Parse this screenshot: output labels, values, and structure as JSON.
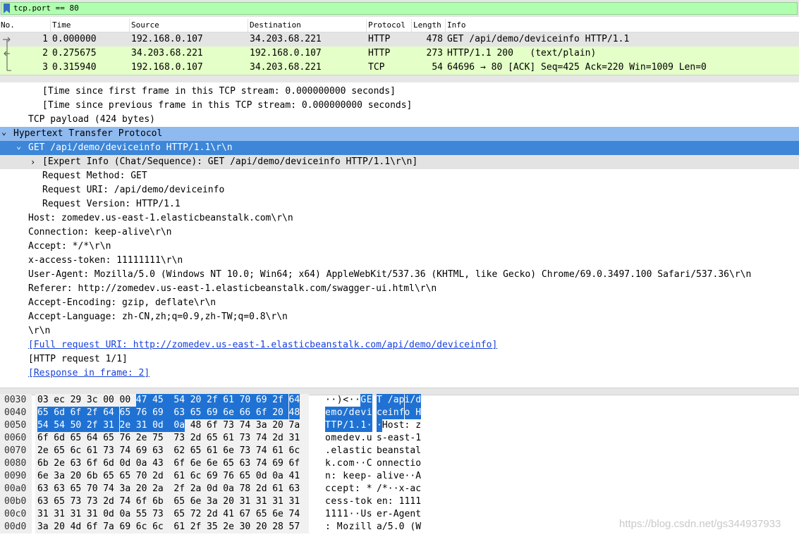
{
  "filter": {
    "value": "tcp.port == 80",
    "icon": "bookmark-icon",
    "bg_color": "#afffaf"
  },
  "packet_list": {
    "columns": [
      "No.",
      "Time",
      "Source",
      "Destination",
      "Protocol",
      "Length",
      "Info"
    ],
    "rows": [
      {
        "no": "1",
        "time": "0.000000",
        "source": "192.168.0.107",
        "destination": "34.203.68.221",
        "protocol": "HTTP",
        "length": "478",
        "info": "GET /api/demo/deviceinfo HTTP/1.1",
        "bg": "#e4e4e4"
      },
      {
        "no": "2",
        "time": "0.275675",
        "source": "34.203.68.221",
        "destination": "192.168.0.107",
        "protocol": "HTTP",
        "length": "273",
        "info": "HTTP/1.1 200   (text/plain)",
        "bg": "#e4ffc7"
      },
      {
        "no": "3",
        "time": "0.315940",
        "source": "192.168.0.107",
        "destination": "34.203.68.221",
        "protocol": "TCP",
        "length": "54",
        "info": "64696 → 80 [ACK] Seq=425 Ack=220 Win=1009 Len=0",
        "bg": "#e4ffc7"
      }
    ]
  },
  "details": [
    {
      "text": "[Time since first frame in this TCP stream: 0.000000000 seconds]",
      "indent": 3
    },
    {
      "text": "[Time since previous frame in this TCP stream: 0.000000000 seconds]",
      "indent": 3
    },
    {
      "text": "TCP payload (424 bytes)",
      "indent": 2
    },
    {
      "text": "Hypertext Transfer Protocol",
      "indent": 1,
      "caret": "expanded",
      "highlight": "light"
    },
    {
      "text": "GET /api/demo/deviceinfo HTTP/1.1\\r\\n",
      "indent": 2,
      "caret": "expanded",
      "highlight": "dark"
    },
    {
      "text": "[Expert Info (Chat/Sequence): GET /api/demo/deviceinfo HTTP/1.1\\r\\n]",
      "indent": 3,
      "caret": "collapsed",
      "highlight": "grey"
    },
    {
      "text": "Request Method: GET",
      "indent": 3
    },
    {
      "text": "Request URI: /api/demo/deviceinfo",
      "indent": 3
    },
    {
      "text": "Request Version: HTTP/1.1",
      "indent": 3
    },
    {
      "text": "Host: zomedev.us-east-1.elasticbeanstalk.com\\r\\n",
      "indent": 2
    },
    {
      "text": "Connection: keep-alive\\r\\n",
      "indent": 2
    },
    {
      "text": "Accept: */*\\r\\n",
      "indent": 2
    },
    {
      "text": "x-access-token: 11111111\\r\\n",
      "indent": 2
    },
    {
      "text": "User-Agent: Mozilla/5.0 (Windows NT 10.0; Win64; x64) AppleWebKit/537.36 (KHTML, like Gecko) Chrome/69.0.3497.100 Safari/537.36\\r\\n",
      "indent": 2
    },
    {
      "text": "Referer: http://zomedev.us-east-1.elasticbeanstalk.com/swagger-ui.html\\r\\n",
      "indent": 2
    },
    {
      "text": "Accept-Encoding: gzip, deflate\\r\\n",
      "indent": 2
    },
    {
      "text": "Accept-Language: zh-CN,zh;q=0.9,zh-TW;q=0.8\\r\\n",
      "indent": 2
    },
    {
      "text": "\\r\\n",
      "indent": 2
    },
    {
      "text": "[Full request URI: http://zomedev.us-east-1.elasticbeanstalk.com/api/demo/deviceinfo]",
      "indent": 2,
      "link": true
    },
    {
      "text": "[HTTP request 1/1]",
      "indent": 2
    },
    {
      "text": "[Response in frame: 2]",
      "indent": 2,
      "link": true
    }
  ],
  "bytes": [
    {
      "offset": "0030",
      "hex": [
        "03",
        "ec",
        "29",
        "3c",
        "00",
        "00",
        "47",
        "45",
        "54",
        "20",
        "2f",
        "61",
        "70",
        "69",
        "2f",
        "64"
      ],
      "ascii": "··)<··GET /api/d",
      "sel_start": 6,
      "sel_end": 16
    },
    {
      "offset": "0040",
      "hex": [
        "65",
        "6d",
        "6f",
        "2f",
        "64",
        "65",
        "76",
        "69",
        "63",
        "65",
        "69",
        "6e",
        "66",
        "6f",
        "20",
        "48"
      ],
      "ascii": "emo/deviceinfo H",
      "sel_start": 0,
      "sel_end": 16
    },
    {
      "offset": "0050",
      "hex": [
        "54",
        "54",
        "50",
        "2f",
        "31",
        "2e",
        "31",
        "0d",
        "0a",
        "48",
        "6f",
        "73",
        "74",
        "3a",
        "20",
        "7a"
      ],
      "ascii": "TTP/1.1··Host: z",
      "sel_start": 0,
      "sel_end": 9
    },
    {
      "offset": "0060",
      "hex": [
        "6f",
        "6d",
        "65",
        "64",
        "65",
        "76",
        "2e",
        "75",
        "73",
        "2d",
        "65",
        "61",
        "73",
        "74",
        "2d",
        "31"
      ],
      "ascii": "omedev.us-east-1",
      "sel_start": 0,
      "sel_end": 0
    },
    {
      "offset": "0070",
      "hex": [
        "2e",
        "65",
        "6c",
        "61",
        "73",
        "74",
        "69",
        "63",
        "62",
        "65",
        "61",
        "6e",
        "73",
        "74",
        "61",
        "6c"
      ],
      "ascii": ".elasticbeanstal",
      "sel_start": 0,
      "sel_end": 0
    },
    {
      "offset": "0080",
      "hex": [
        "6b",
        "2e",
        "63",
        "6f",
        "6d",
        "0d",
        "0a",
        "43",
        "6f",
        "6e",
        "6e",
        "65",
        "63",
        "74",
        "69",
        "6f"
      ],
      "ascii": "k.com··Connectio",
      "sel_start": 0,
      "sel_end": 0
    },
    {
      "offset": "0090",
      "hex": [
        "6e",
        "3a",
        "20",
        "6b",
        "65",
        "65",
        "70",
        "2d",
        "61",
        "6c",
        "69",
        "76",
        "65",
        "0d",
        "0a",
        "41"
      ],
      "ascii": "n: keep-alive··A",
      "sel_start": 0,
      "sel_end": 0
    },
    {
      "offset": "00a0",
      "hex": [
        "63",
        "63",
        "65",
        "70",
        "74",
        "3a",
        "20",
        "2a",
        "2f",
        "2a",
        "0d",
        "0a",
        "78",
        "2d",
        "61",
        "63"
      ],
      "ascii": "ccept: */*··x-ac",
      "sel_start": 0,
      "sel_end": 0
    },
    {
      "offset": "00b0",
      "hex": [
        "63",
        "65",
        "73",
        "73",
        "2d",
        "74",
        "6f",
        "6b",
        "65",
        "6e",
        "3a",
        "20",
        "31",
        "31",
        "31",
        "31"
      ],
      "ascii": "cess-token: 1111",
      "sel_start": 0,
      "sel_end": 0
    },
    {
      "offset": "00c0",
      "hex": [
        "31",
        "31",
        "31",
        "31",
        "0d",
        "0a",
        "55",
        "73",
        "65",
        "72",
        "2d",
        "41",
        "67",
        "65",
        "6e",
        "74"
      ],
      "ascii": "1111··User-Agent",
      "sel_start": 0,
      "sel_end": 0
    },
    {
      "offset": "00d0",
      "hex": [
        "3a",
        "20",
        "4d",
        "6f",
        "7a",
        "69",
        "6c",
        "6c",
        "61",
        "2f",
        "35",
        "2e",
        "30",
        "20",
        "28",
        "57"
      ],
      "ascii": ": Mozilla/5.0 (W",
      "sel_start": 0,
      "sel_end": 0
    }
  ],
  "watermark": "https://blog.csdn.net/gs344937933"
}
